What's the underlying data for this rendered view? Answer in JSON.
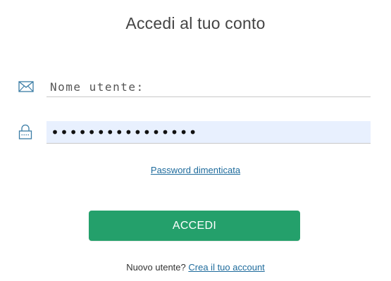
{
  "page": {
    "title": "Accedi al tuo conto"
  },
  "form": {
    "username": {
      "icon": "envelope-icon",
      "placeholder": "Nome utente:",
      "value": ""
    },
    "password": {
      "icon": "lock-icon",
      "value": "••••••••••••••••",
      "autofill_background": "#e8f0fe"
    },
    "forgot_link_label": "Password dimenticata",
    "submit_label": "ACCEDI",
    "submit_color": "#24a06b"
  },
  "signup": {
    "prompt": "Nuovo utente?",
    "link_label": "Crea il tuo account"
  },
  "colors": {
    "link": "#1e6b9c",
    "icon": "#3a7ca5"
  }
}
